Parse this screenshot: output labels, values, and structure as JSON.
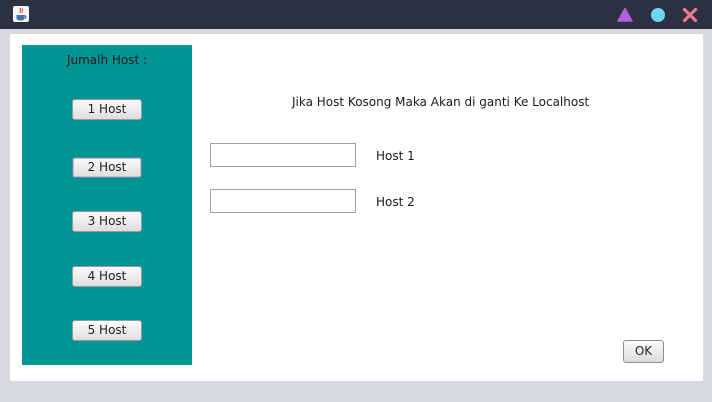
{
  "window": {
    "controls": {
      "minimize_icon": "triangle-icon",
      "maximize_icon": "circle-icon",
      "close_icon": "x-icon",
      "colors": {
        "minimize": "#b35fe0",
        "maximize": "#6ad8ef",
        "close": "#f07a8f"
      }
    }
  },
  "sidebar": {
    "title": "Jumalh Host  :",
    "color": "#009494",
    "buttons": [
      {
        "label": "1 Host"
      },
      {
        "label": "2 Host"
      },
      {
        "label": "3 Host"
      },
      {
        "label": "4 Host"
      },
      {
        "label": "5 Host"
      }
    ]
  },
  "main": {
    "info": "Jika Host Kosong Maka Akan di ganti Ke Localhost",
    "fields": [
      {
        "label": "Host 1",
        "value": ""
      },
      {
        "label": "Host 2",
        "value": ""
      }
    ],
    "ok_label": "OK"
  }
}
